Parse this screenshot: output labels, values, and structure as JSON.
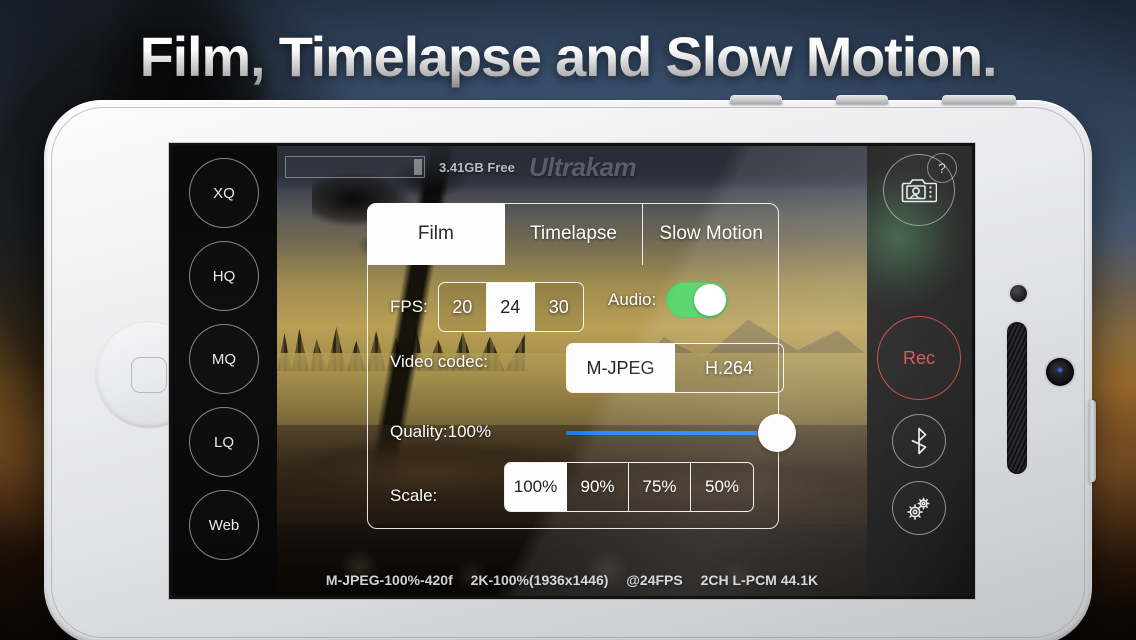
{
  "promo": {
    "headline": "Film, Timelapse and Slow Motion."
  },
  "app": {
    "brand": "Ultrakam",
    "storage_text": "3.41GB Free",
    "help_label": "?"
  },
  "left_rail": {
    "items": [
      {
        "label": "XQ",
        "icon": "quality-xq-icon"
      },
      {
        "label": "HQ",
        "icon": "quality-hq-icon"
      },
      {
        "label": "MQ",
        "icon": "quality-mq-icon"
      },
      {
        "label": "LQ",
        "icon": "quality-lq-icon"
      },
      {
        "label": "Web",
        "icon": "quality-web-icon"
      }
    ]
  },
  "right_rail": {
    "gallery_icon": "camera-gallery-icon",
    "record_label": "Rec",
    "bluetooth_icon": "bluetooth-icon",
    "settings_icon": "gears-icon"
  },
  "panel": {
    "tabs": [
      {
        "label": "Film",
        "active": true
      },
      {
        "label": "Timelapse",
        "active": false
      },
      {
        "label": "Slow Motion",
        "active": false
      }
    ],
    "fps": {
      "label": "FPS:",
      "options": [
        "20",
        "24",
        "30"
      ],
      "selected": "24"
    },
    "audio": {
      "label": "Audio:",
      "enabled": true,
      "on_color": "#4ad15f"
    },
    "codec": {
      "label": "Video codec:",
      "options": [
        "M-JPEG",
        "H.264"
      ],
      "selected": "M-JPEG"
    },
    "quality": {
      "label": "Quality:100%",
      "value": 100,
      "track_color": "#1b7eef"
    },
    "scale": {
      "label": "Scale:",
      "options": [
        "100%",
        "90%",
        "75%",
        "50%"
      ],
      "selected": "100%"
    }
  },
  "status": {
    "codec_info": "M-JPEG-100%-420f",
    "resolution_info": "2K-100%(1936x1446)",
    "fps_info": "@24FPS",
    "audio_info": "2CH L-PCM 44.1K"
  }
}
